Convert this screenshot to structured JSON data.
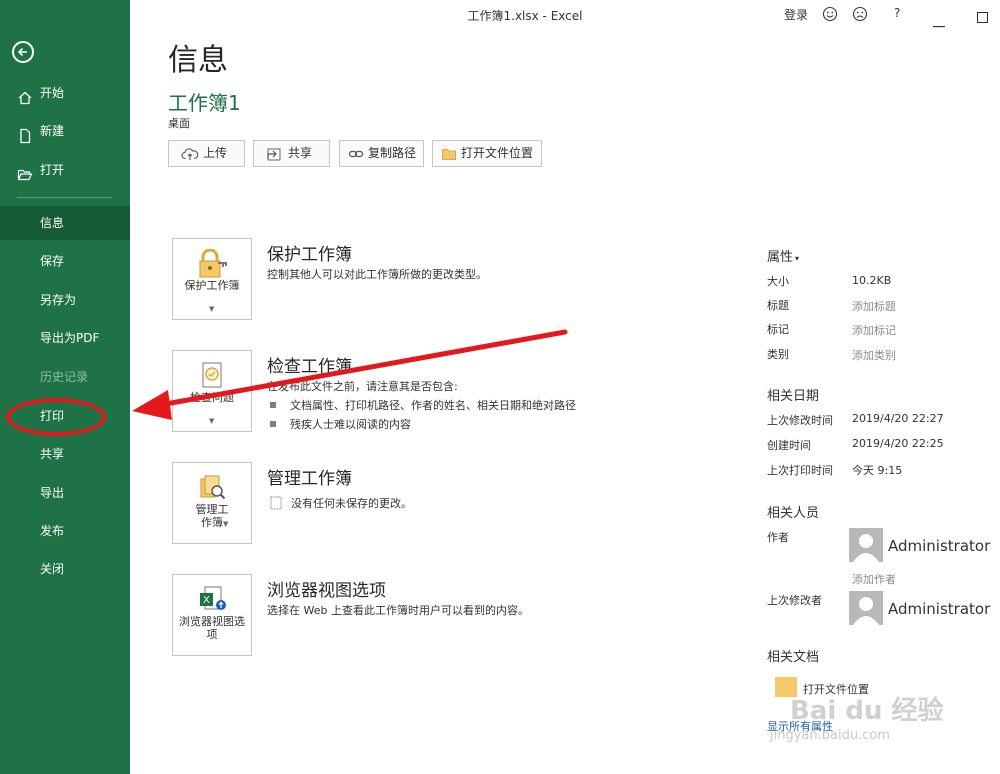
{
  "window": {
    "title": "工作簿1.xlsx  -  Excel",
    "signin": "登录",
    "help": "?"
  },
  "sidebar": {
    "items": [
      {
        "label": "开始",
        "icon": "home-icon"
      },
      {
        "label": "新建",
        "icon": "new-document-icon"
      },
      {
        "label": "打开",
        "icon": "open-folder-icon"
      },
      {
        "label": "信息",
        "selected": true
      },
      {
        "label": "保存"
      },
      {
        "label": "另存为"
      },
      {
        "label": "导出为PDF"
      },
      {
        "label": "历史记录",
        "disabled": true
      },
      {
        "label": "打印"
      },
      {
        "label": "共享"
      },
      {
        "label": "导出"
      },
      {
        "label": "发布"
      },
      {
        "label": "关闭"
      }
    ]
  },
  "main": {
    "heading": "信息",
    "doc_name": "工作簿1",
    "doc_location": "桌面",
    "actions": [
      {
        "label": "上传",
        "icon": "upload-cloud-icon"
      },
      {
        "label": "共享",
        "icon": "share-icon"
      },
      {
        "label": "复制路径",
        "icon": "link-icon"
      },
      {
        "label": "打开文件位置",
        "icon": "folder-icon"
      }
    ],
    "sections": [
      {
        "button_label": "保护工作簿",
        "title": "保护工作簿",
        "desc": "控制其他人可以对此工作簿所做的更改类型。"
      },
      {
        "button_label": "检查问题",
        "title": "检查工作簿",
        "desc": "在发布此文件之前，请注意其是否包含:",
        "bullets": [
          "文档属性、打印机路径、作者的姓名、相关日期和绝对路径",
          "残疾人士难以阅读的内容"
        ]
      },
      {
        "button_label": "管理工作簿",
        "title": "管理工作簿",
        "desc": "没有任何未保存的更改。"
      },
      {
        "button_label": "浏览器视图选项",
        "title": "浏览器视图选项",
        "desc": "选择在 Web 上查看此工作簿时用户可以看到的内容。"
      }
    ]
  },
  "properties": {
    "heading": "属性",
    "rows": [
      {
        "label": "大小",
        "value": "10.2KB",
        "muted": false
      },
      {
        "label": "标题",
        "value": "添加标题",
        "muted": true
      },
      {
        "label": "标记",
        "value": "添加标记",
        "muted": true
      },
      {
        "label": "类别",
        "value": "添加类别",
        "muted": true
      }
    ],
    "dates_heading": "相关日期",
    "dates": [
      {
        "label": "上次修改时间",
        "value": "2019/4/20 22:27"
      },
      {
        "label": "创建时间",
        "value": "2019/4/20 22:25"
      },
      {
        "label": "上次打印时间",
        "value": "今天 9:15"
      }
    ],
    "people_heading": "相关人员",
    "author_label": "作者",
    "author_name": "Administrator",
    "add_author": "添加作者",
    "modifier_label": "上次修改者",
    "modifier_name": "Administrator",
    "docs_heading": "相关文档",
    "open_location": "打开文件位置",
    "show_all": "显示所有属性"
  },
  "watermark": {
    "text": "Bai du 经验",
    "url": "jingyan.baidu.com"
  },
  "colors": {
    "sidebar": "#1f7246",
    "sidebar_selected": "#155b35",
    "accent": "#1f7246",
    "annotation": "#e5191d"
  }
}
